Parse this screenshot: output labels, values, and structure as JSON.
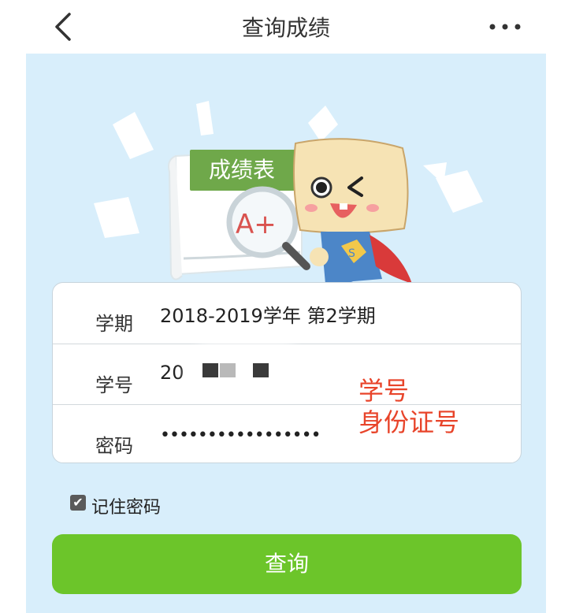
{
  "header": {
    "title": "查询成绩"
  },
  "hero": {
    "sheet_title": "成绩表",
    "grade": "A+",
    "badge_letter": "S"
  },
  "form": {
    "rows": [
      {
        "label": "学期",
        "value": "2018-2019学年 第2学期"
      },
      {
        "label": "学号",
        "value": "20"
      },
      {
        "label": "密码",
        "value": "•••••••••••••••••"
      }
    ]
  },
  "annotation": {
    "line1": "学号",
    "line2": "身份证号"
  },
  "remember": {
    "checked": true,
    "label": "记住密码"
  },
  "actions": {
    "query_label": "查询"
  },
  "colors": {
    "background": "#d8eefb",
    "accent_green": "#6cc52a",
    "annotation_red": "#e8442a"
  }
}
